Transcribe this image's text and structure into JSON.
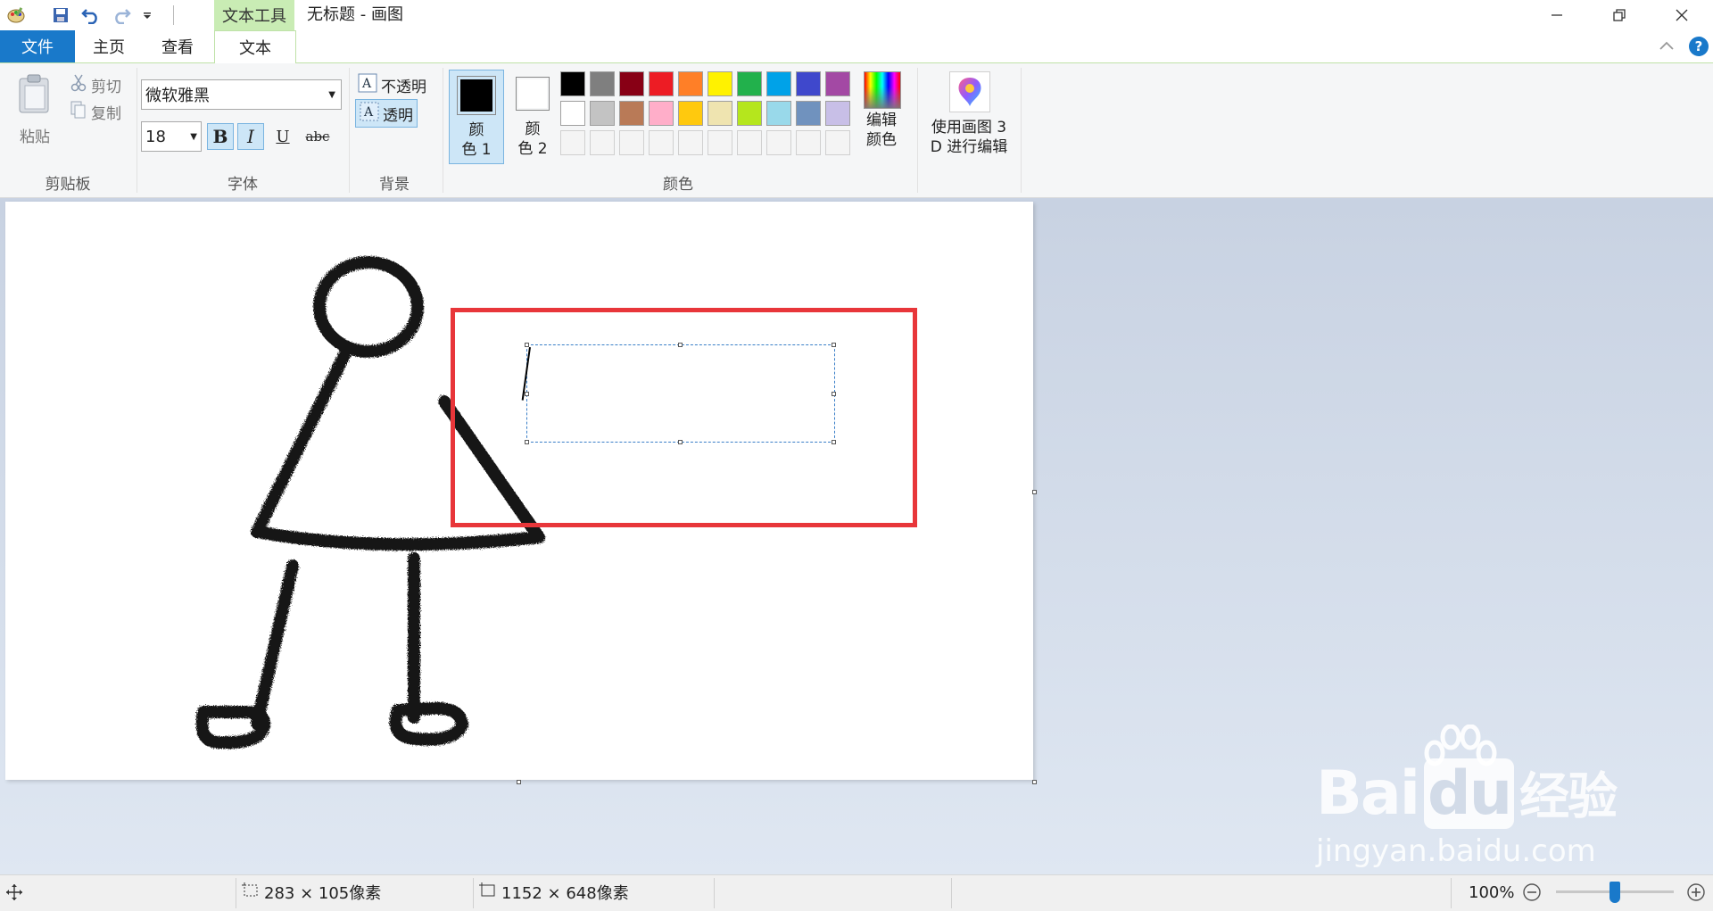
{
  "titlebar": {
    "context_tab": "文本工具",
    "title": "无标题 - 画图",
    "qat_icons": [
      "paint-app-icon",
      "save-icon",
      "undo-icon",
      "redo-icon",
      "customize-dropdown-icon"
    ],
    "controls": [
      "minimize",
      "restore",
      "close"
    ]
  },
  "tabs": {
    "file": "文件",
    "home": "主页",
    "view": "查看",
    "text": "文本"
  },
  "clipboard": {
    "paste": "粘贴",
    "cut": "剪切",
    "copy": "复制",
    "group": "剪贴板"
  },
  "font": {
    "family": "微软雅黑",
    "size": "18",
    "bold": "B",
    "italic": "I",
    "underline": "U",
    "strike": "abc",
    "group": "字体"
  },
  "background": {
    "opaque": "不透明",
    "transparent": "透明",
    "group": "背景"
  },
  "colors": {
    "color1_line1": "颜",
    "color1_line2": "色 1",
    "color2_line1": "颜",
    "color2_line2": "色 2",
    "edit_line1": "编辑",
    "edit_line2": "颜色",
    "group": "颜色",
    "color1": "#000000",
    "color2": "#ffffff",
    "row1": [
      "#000000",
      "#7f7f7f",
      "#880015",
      "#ed1c24",
      "#ff7f27",
      "#fff200",
      "#22b14c",
      "#00a2e8",
      "#3f48cc",
      "#a349a4"
    ],
    "row2": [
      "#ffffff",
      "#c3c3c3",
      "#b97a57",
      "#ffaec9",
      "#ffc90e",
      "#efe4b0",
      "#b5e61d",
      "#99d9ea",
      "#7092be",
      "#c8bfe7"
    ]
  },
  "paint3d": {
    "line1": "使用画图 3",
    "line2": "D 进行编辑"
  },
  "status": {
    "selection": "283 × 105像素",
    "canvas_size": "1152 × 648像素",
    "zoom": "100%",
    "zoom_fraction": 0.5
  },
  "watermark": {
    "brand": "Bai",
    "brand2": "du",
    "cn": "经验",
    "url": "jingyan.baidu.com"
  },
  "accent": "#1979ca",
  "highlight_box_color": "#e8363a"
}
